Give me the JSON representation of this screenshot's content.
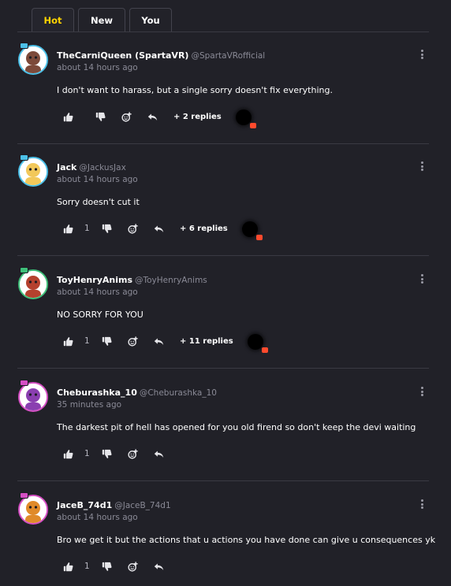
{
  "tabs": [
    "Hot",
    "New",
    "You"
  ],
  "comments": [
    {
      "name": "TheCarniQueen (SpartaVR)",
      "handle": "@SpartaVRofficial",
      "time": "about 14 hours ago",
      "text": "I don't want to harass, but a single sorry doesn't fix everything.",
      "likes": "",
      "replies": "+ 2 replies",
      "avatar_ring": "#4cc0e8",
      "avatar_color": "#7c4a3a"
    },
    {
      "name": "Jack",
      "handle": "@JackusJax",
      "time": "about 14 hours ago",
      "text": "Sorry doesn't cut it",
      "likes": "1",
      "replies": "+ 6 replies",
      "avatar_ring": "#4cc0e8",
      "avatar_color": "#f2c85a"
    },
    {
      "name": "ToyHenryAnims",
      "handle": "@ToyHenryAnims",
      "time": "about 14 hours ago",
      "text": "NO SORRY FOR YOU",
      "likes": "1",
      "replies": "+ 11 replies",
      "avatar_ring": "#3fc07a",
      "avatar_color": "#b5412e"
    },
    {
      "name": "Cheburashka_10",
      "handle": "@Cheburashka_10",
      "time": "35 minutes ago",
      "text": "The darkest pit of hell has opened for you old firend so don't keep the devi waiting",
      "likes": "1",
      "replies": "",
      "avatar_ring": "#d54fc4",
      "avatar_color": "#8a3fb0"
    },
    {
      "name": "JaceB_74d1",
      "handle": "@JaceB_74d1",
      "time": "about 14 hours ago",
      "text": "Bro we get it but the actions that u actions you have done can give u consequences yk",
      "likes": "1",
      "replies": "",
      "avatar_ring": "#d54fc4",
      "avatar_color": "#e08a2a"
    }
  ],
  "colors": {
    "background": "#212128",
    "active_tab": "#ffd400",
    "divider": "#3a3a43",
    "muted_text": "#8a8a96",
    "notification_badge": "#ff4a2d"
  },
  "icons": [
    "thumbs-up-icon",
    "thumbs-down-icon",
    "add-emoji-icon",
    "reply-icon",
    "more-options-icon"
  ]
}
